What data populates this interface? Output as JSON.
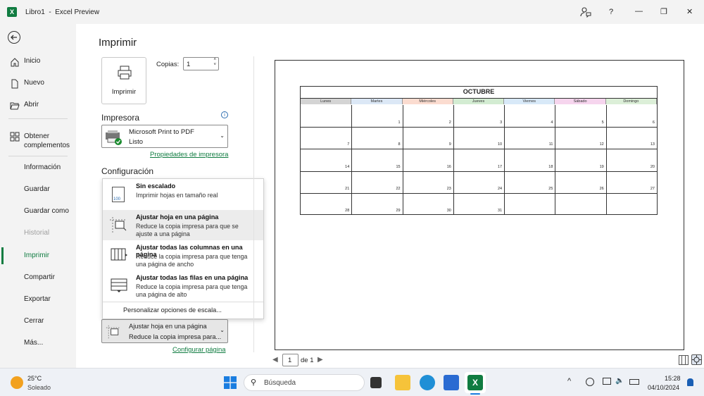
{
  "window": {
    "app_logo": "excel-logo-icon",
    "title": "Libro1  -  Excel Preview"
  },
  "titlebar_icons": [
    "feedback-icon",
    "help-icon",
    "minimize-icon",
    "restore-icon",
    "close-icon"
  ],
  "titlebar_glyphs": {
    "help": "?",
    "minimize": "—",
    "restore": "❐",
    "close": "✕"
  },
  "nav": {
    "inicio": "Inicio",
    "nuevo": "Nuevo",
    "abrir": "Abrir",
    "complementos_line1": "Obtener",
    "complementos_line2": "complementos",
    "informacion": "Información",
    "guardar": "Guardar",
    "guardar_como": "Guardar como",
    "historial": "Historial",
    "imprimir": "Imprimir",
    "compartir": "Compartir",
    "exportar": "Exportar",
    "cerrar": "Cerrar",
    "mas": "Más..."
  },
  "print": {
    "heading": "Imprimir",
    "print_button": "Imprimir",
    "copies_label": "Copias:",
    "copies_value": "1",
    "printer_section": "Impresora",
    "printer_name": "Microsoft Print to PDF",
    "printer_status": "Listo",
    "printer_properties": "Propiedades de impresora",
    "settings_section": "Configuración",
    "scaling_selected_title": "Ajustar hoja en una página",
    "scaling_selected_desc": "Reduce la copia impresa para...",
    "page_setup_link": "Configurar página"
  },
  "scaling_menu": [
    {
      "title": "Sin escalado",
      "desc1": "Imprimir hojas en tamaño real",
      "desc2": "",
      "icon": "no-scaling-icon",
      "icon_text": "100"
    },
    {
      "title": "Ajustar hoja en una página",
      "desc1": "Reduce la copia impresa para que se",
      "desc2": "ajuste a una página",
      "icon": "fit-sheet-icon"
    },
    {
      "title": "Ajustar todas las columnas en una página",
      "desc1": "Reduce la copia impresa para que tenga",
      "desc2": "una página de ancho",
      "icon": "fit-columns-icon"
    },
    {
      "title": "Ajustar todas las filas en una página",
      "desc1": "Reduce la copia impresa para que tenga",
      "desc2": "una página de alto",
      "icon": "fit-rows-icon"
    }
  ],
  "scaling_custom": "Personalizar opciones de escala...",
  "preview": {
    "calendar_title": "OCTUBRE",
    "days": [
      "Lunes",
      "Martes",
      "Miércoles",
      "Jueves",
      "Viernes",
      "Sábado",
      "Domingo"
    ],
    "day_colors": [
      "#d4d4d4",
      "#dce8f6",
      "#fbdcd0",
      "#d3ecd2",
      "#d8e9f8",
      "#f6d5ee",
      "#dcefd8"
    ],
    "weeks": [
      [
        "",
        "",
        "",
        "",
        "",
        "",
        ""
      ],
      [
        "",
        "1",
        "2",
        "3",
        "4",
        "5",
        "6"
      ],
      [
        "7",
        "8",
        "9",
        "10",
        "11",
        "12",
        "13"
      ],
      [
        "14",
        "15",
        "16",
        "17",
        "18",
        "19",
        "20"
      ],
      [
        "21",
        "22",
        "23",
        "24",
        "25",
        "26",
        "27"
      ],
      [
        "28",
        "29",
        "30",
        "31",
        "",
        "",
        ""
      ]
    ],
    "page_current": "1",
    "page_total_label": "de 1"
  },
  "taskbar": {
    "weather_temp": "25°C",
    "weather_desc": "Soleado",
    "search_placeholder": "Búsqueda",
    "time": "15:28",
    "date": "04/10/2024"
  },
  "colors": {
    "accent_green": "#107c41",
    "link_green": "#107c41",
    "nav_active": "#107c41"
  }
}
